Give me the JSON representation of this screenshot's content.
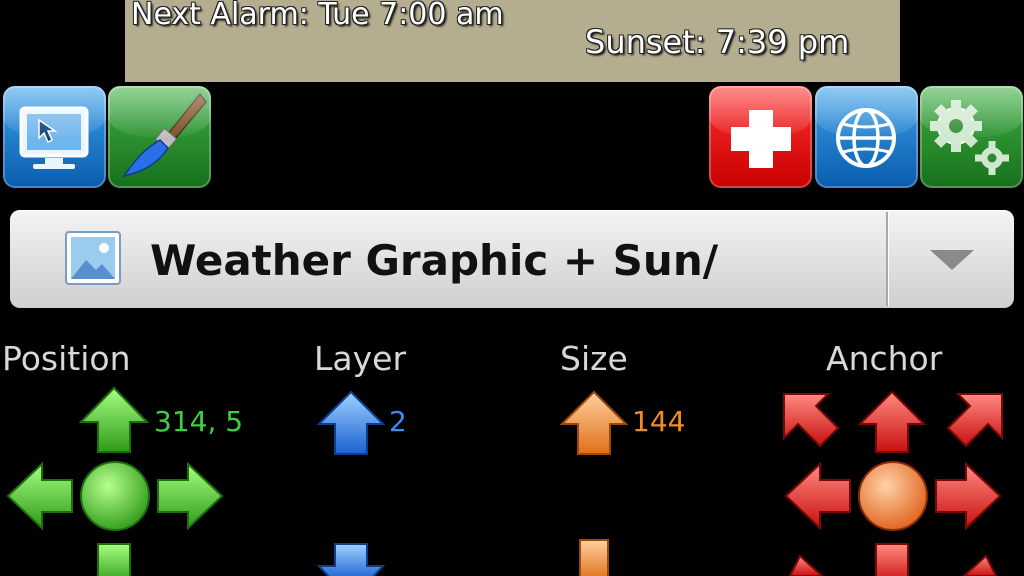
{
  "info": {
    "next_alarm": "Next Alarm: Tue  7:00 am",
    "sunset": "Sunset:  7:39 pm"
  },
  "toolbar": {
    "left": [
      {
        "name": "display-button",
        "icon": "monitor-cursor-icon",
        "color": "#1a7fd4"
      },
      {
        "name": "paint-button",
        "icon": "paintbrush-icon",
        "color": "#2e9a33"
      }
    ],
    "right": [
      {
        "name": "add-button",
        "icon": "plus-icon",
        "color": "#e00000"
      },
      {
        "name": "web-button",
        "icon": "globe-icon",
        "color": "#1a7fd4"
      },
      {
        "name": "settings-button",
        "icon": "gears-icon",
        "color": "#2e9a33"
      }
    ]
  },
  "spinner": {
    "selected": "Weather Graphic + Sun/",
    "icon": "image-icon"
  },
  "controls": {
    "position": {
      "label": "Position",
      "value": "314, 5",
      "color": "#3fd03f"
    },
    "layer": {
      "label": "Layer",
      "value": "2",
      "color": "#3b8ef0"
    },
    "size": {
      "label": "Size",
      "value": "144",
      "color": "#f08a2a"
    },
    "anchor": {
      "label": "Anchor",
      "color": "#e02020"
    }
  }
}
